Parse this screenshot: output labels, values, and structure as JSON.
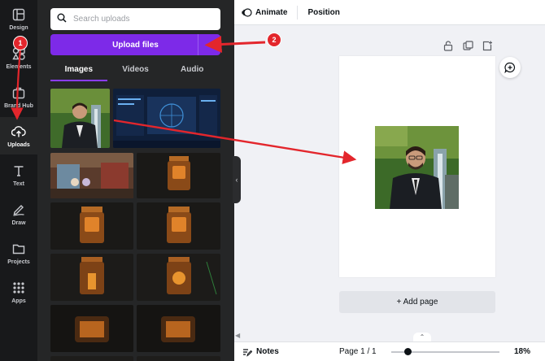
{
  "rail": {
    "items": [
      {
        "label": "Design",
        "icon": "design-icon"
      },
      {
        "label": "Elements",
        "icon": "elements-icon"
      },
      {
        "label": "Brand Hub",
        "icon": "brand-hub-icon"
      },
      {
        "label": "Uploads",
        "icon": "uploads-icon",
        "active": true
      },
      {
        "label": "Text",
        "icon": "text-icon"
      },
      {
        "label": "Draw",
        "icon": "draw-icon"
      },
      {
        "label": "Projects",
        "icon": "projects-icon"
      },
      {
        "label": "Apps",
        "icon": "apps-icon"
      }
    ]
  },
  "panel": {
    "search_placeholder": "Search uploads",
    "upload_label": "Upload files",
    "tabs": [
      {
        "label": "Images",
        "active": true
      },
      {
        "label": "Videos"
      },
      {
        "label": "Audio"
      }
    ]
  },
  "toolbar": {
    "animate_label": "Animate",
    "position_label": "Position"
  },
  "canvas": {
    "add_page_label": "+ Add page"
  },
  "bottom": {
    "notes_label": "Notes",
    "page_indicator": "Page 1 / 1",
    "zoom_value": "18%",
    "zoom_level": 0.18
  },
  "annotations": {
    "badge_1": "1",
    "badge_2": "2",
    "color": "#e3262c"
  },
  "colors": {
    "accent": "#7d2ae8",
    "rail_bg": "#18191b",
    "panel_bg": "#252627",
    "canvas_bg": "#f0f1f5"
  }
}
